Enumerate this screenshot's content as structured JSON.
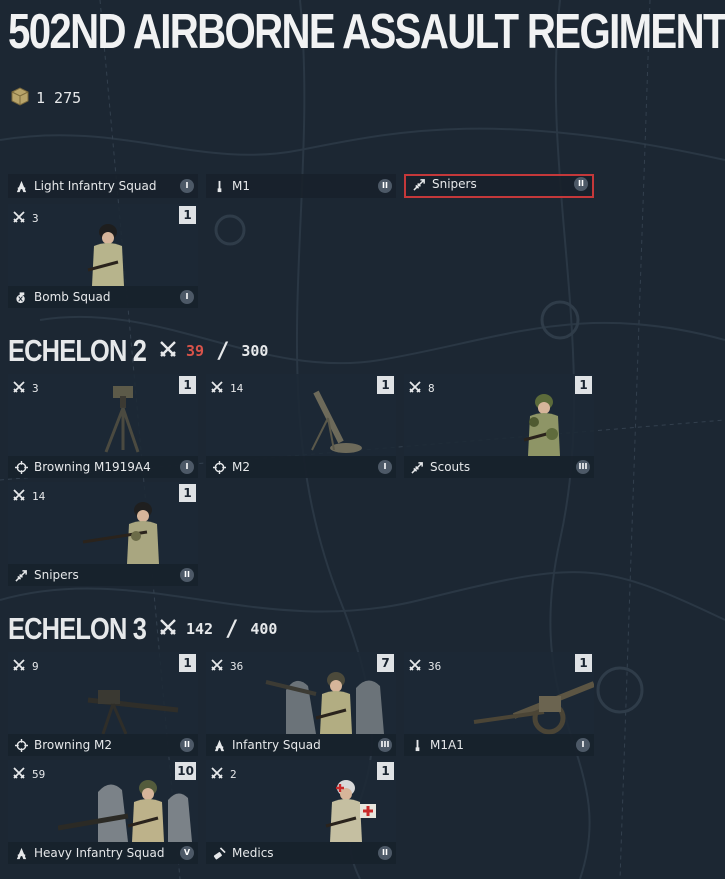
{
  "title": "502ND AIRBORNE ASSAULT REGIMENT",
  "currency": {
    "icon": "supply-crate-icon",
    "value": "1 275"
  },
  "colors": {
    "selected_border": "#c4383a",
    "over_capacity": "#d9534a",
    "count_badge": "#dfe2e5"
  },
  "echelon1": {
    "row_a": [
      {
        "name": "Light Infantry Squad",
        "type_icon": "infantry-icon",
        "tier": "I",
        "selected": false
      },
      {
        "name": "M1",
        "type_icon": "rifle-icon",
        "tier": "II",
        "selected": false
      },
      {
        "name": "Snipers",
        "type_icon": "sniper-icon",
        "tier": "II",
        "selected": true
      }
    ],
    "cards": [
      {
        "name": "Bomb Squad",
        "type_icon": "grenade-icon",
        "tier": "I",
        "men": "3",
        "count": "1",
        "art": "soldier-helmet"
      }
    ]
  },
  "echelon2": {
    "title": "ECHELON 2",
    "current": "39",
    "max": "300",
    "cards": [
      {
        "name": "Browning M1919A4",
        "type_icon": "crosshair-icon",
        "tier": "I",
        "men": "3",
        "count": "1",
        "art": "mg-tripod"
      },
      {
        "name": "M2",
        "type_icon": "crosshair-icon",
        "tier": "I",
        "men": "14",
        "count": "1",
        "art": "mortar"
      },
      {
        "name": "Scouts",
        "type_icon": "sniper-icon",
        "tier": "III",
        "men": "8",
        "count": "1",
        "art": "soldier-boonie"
      },
      {
        "name": "Snipers",
        "type_icon": "sniper-icon",
        "tier": "II",
        "men": "14",
        "count": "1",
        "art": "soldier-prone-rifle"
      }
    ]
  },
  "echelon3": {
    "title": "ECHELON 3",
    "current": "142",
    "max": "400",
    "cards": [
      {
        "name": "Browning M2",
        "type_icon": "crosshair-icon",
        "tier": "II",
        "men": "9",
        "count": "1",
        "art": "hmg"
      },
      {
        "name": "Infantry Squad",
        "type_icon": "infantry-icon",
        "tier": "III",
        "men": "36",
        "count": "7",
        "art": "squad"
      },
      {
        "name": "M1A1",
        "type_icon": "rifle-icon",
        "tier": "I",
        "men": "36",
        "count": "1",
        "art": "howitzer"
      },
      {
        "name": "Heavy Infantry Squad",
        "type_icon": "infantry-icon",
        "tier": "V",
        "men": "59",
        "count": "10",
        "art": "squad-heavy"
      },
      {
        "name": "Medics",
        "type_icon": "medic-icon",
        "tier": "II",
        "men": "2",
        "count": "1",
        "art": "medic"
      }
    ]
  }
}
